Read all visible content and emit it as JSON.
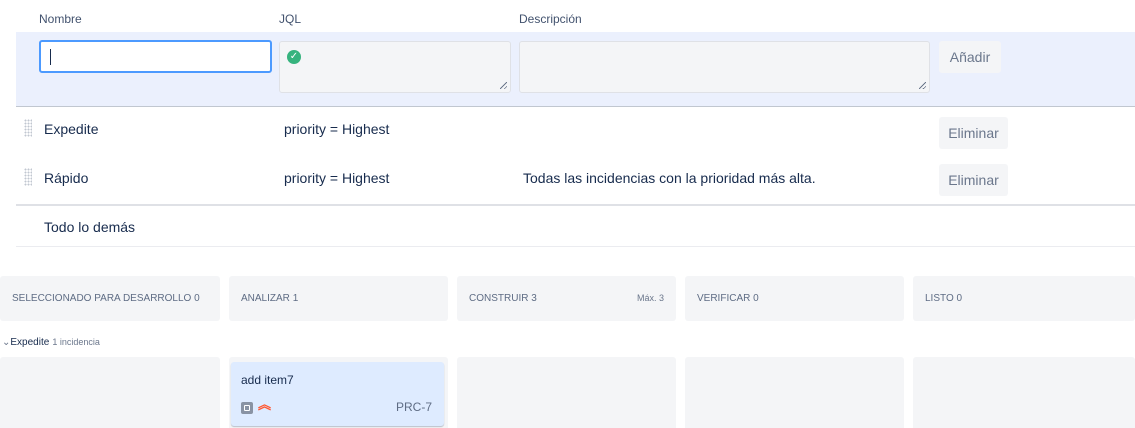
{
  "table": {
    "headers": {
      "name": "Nombre",
      "jql": "JQL",
      "description": "Descripción"
    },
    "add_row": {
      "name_value": "",
      "jql_value": "",
      "description_value": "",
      "add_label": "Añadir",
      "jql_status_icon": "check-circle-icon"
    },
    "rows": [
      {
        "name": "Expedite",
        "jql": "priority = Highest",
        "description": "",
        "delete_label": "Eliminar"
      },
      {
        "name": "Rápido",
        "jql": "priority = Highest",
        "description": "Todas las incidencias con la prioridad más alta.",
        "delete_label": "Eliminar"
      }
    ],
    "default_row": {
      "name": "Todo lo demás"
    }
  },
  "board": {
    "columns": [
      {
        "title": "SELECCIONADO PARA DESARROLLO",
        "count": "0",
        "max": ""
      },
      {
        "title": "ANALIZAR",
        "count": "1",
        "max": ""
      },
      {
        "title": "CONSTRUIR",
        "count": "3",
        "max": "Máx. 3"
      },
      {
        "title": "VERIFICAR",
        "count": "0",
        "max": ""
      },
      {
        "title": "LISTO",
        "count": "0",
        "max": ""
      }
    ],
    "swimlane": {
      "name": "Expedite",
      "count": "1 incidencia"
    },
    "card": {
      "title": "add item7",
      "key": "PRC-7",
      "type_icon": "story-icon",
      "priority_icon": "highest-priority-icon"
    }
  },
  "colors": {
    "accent": "#4c9aff",
    "add_row_bg": "#ebf0fd",
    "card_bg": "#deebff",
    "priority": "#ff5630",
    "valid": "#36b37e"
  }
}
